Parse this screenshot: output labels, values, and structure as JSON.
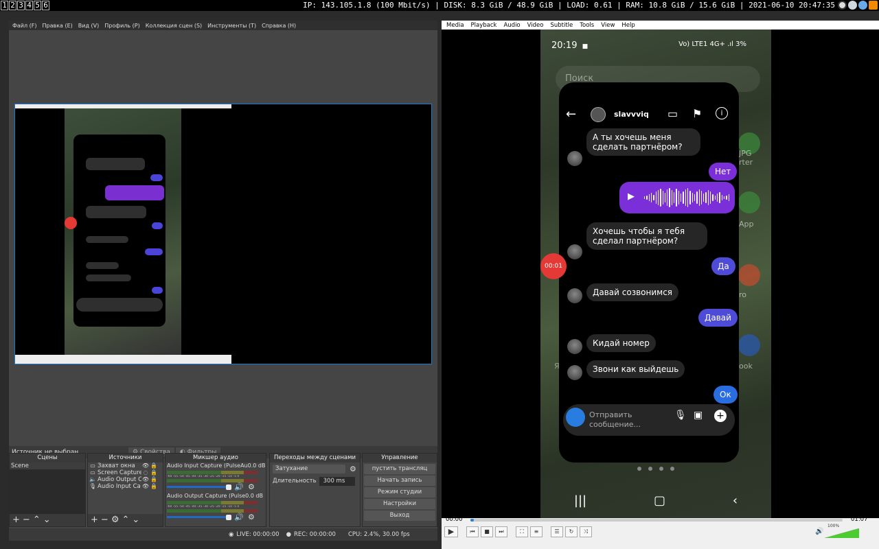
{
  "topbar": {
    "workspaces": [
      "1",
      "2",
      "3",
      "4",
      "5",
      "6"
    ],
    "status": "IP: 143.105.1.8 (100 Mbit/s) | DISK: 8.3 GiB / 48.9 GiB | LOAD: 0.61 | RAM: 10.8 GiB / 15.6 GiB | 2021-06-10 20:47:35",
    "tray_icons": [
      "obs-icon",
      "steam-icon",
      "network-icon",
      "vlc-icon"
    ]
  },
  "obs": {
    "menu": [
      "Файл (F)",
      "Правка (E)",
      "Вид (V)",
      "Профиль (P)",
      "Коллекция сцен (S)",
      "Инструменты (T)",
      "Справка (H)"
    ],
    "source_status": "Источник не выбран",
    "properties_tab": "Свойства",
    "filters_tab": "Фильтры",
    "scenes": {
      "title": "Сцены",
      "items": [
        "Scene"
      ]
    },
    "sources": {
      "title": "Источники",
      "items": [
        {
          "name": "Захват окна",
          "icon": "window-icon"
        },
        {
          "name": "Screen Capture",
          "icon": "monitor-icon"
        },
        {
          "name": "Audio Output C",
          "icon": "speaker-icon"
        },
        {
          "name": "Audio Input Ca",
          "icon": "mic-icon"
        }
      ]
    },
    "mixer": {
      "title": "Микшер аудио",
      "channels": [
        {
          "name": "Audio Input Capture (PulseAu",
          "db": "0.0 dB",
          "level": 0.9
        },
        {
          "name": "Audio Output Capture (Pulse",
          "db": "0.0 dB",
          "level": 0.9
        }
      ],
      "ticks": "-60 -55 -50 -45 -40 -35 -30 -25 -20 -15 -10 -5 0"
    },
    "transitions": {
      "title": "Переходы между сценами",
      "selected": "Затухание",
      "duration_label": "Длительность",
      "duration_value": "300 ms"
    },
    "controls": {
      "title": "Управление",
      "buttons": [
        "пустить трансляц",
        "Начать запись",
        "Режим студии",
        "Настройки",
        "Выход"
      ]
    },
    "statusbar": {
      "live": "LIVE: 00:00:00",
      "rec": "REC: 00:00:00",
      "cpu": "CPU: 2.4%, 30.00 fps"
    }
  },
  "vlc": {
    "menu": [
      "Media",
      "Playback",
      "Audio",
      "Video",
      "Subtitle",
      "Tools",
      "View",
      "Help"
    ],
    "time_current": "00:00",
    "time_total": "01:07",
    "progress": 0.01,
    "volume_label": "100%",
    "volume": 1.0,
    "phone": {
      "clock": "20:19",
      "status_right": "Vo) LTE1 4G+ .ıl 3%",
      "search_placeholder": "Поиск",
      "username": "slavvviq",
      "messages": [
        {
          "from": "them",
          "text": "А ты хочешь меня сделать партнёром?"
        },
        {
          "from": "me",
          "text": "Нет"
        },
        {
          "from": "me",
          "text": "voice"
        },
        {
          "from": "them",
          "text": "Хочешь чтобы я тебя сделал партнёром?"
        },
        {
          "from": "me",
          "text": "Да"
        },
        {
          "from": "them",
          "text": "Давай созвонимся"
        },
        {
          "from": "me",
          "text": "Давай"
        },
        {
          "from": "them",
          "text": "Кидай номер"
        },
        {
          "from": "them",
          "text": "Звони как выйдешь"
        },
        {
          "from": "me",
          "text": "Ок"
        }
      ],
      "recording_timer": "00:01",
      "composer_placeholder": "Отправить сообщение...",
      "background_labels": [
        "JPG",
        "rter",
        "App",
        "ro",
        "ook",
        "Я"
      ]
    }
  }
}
